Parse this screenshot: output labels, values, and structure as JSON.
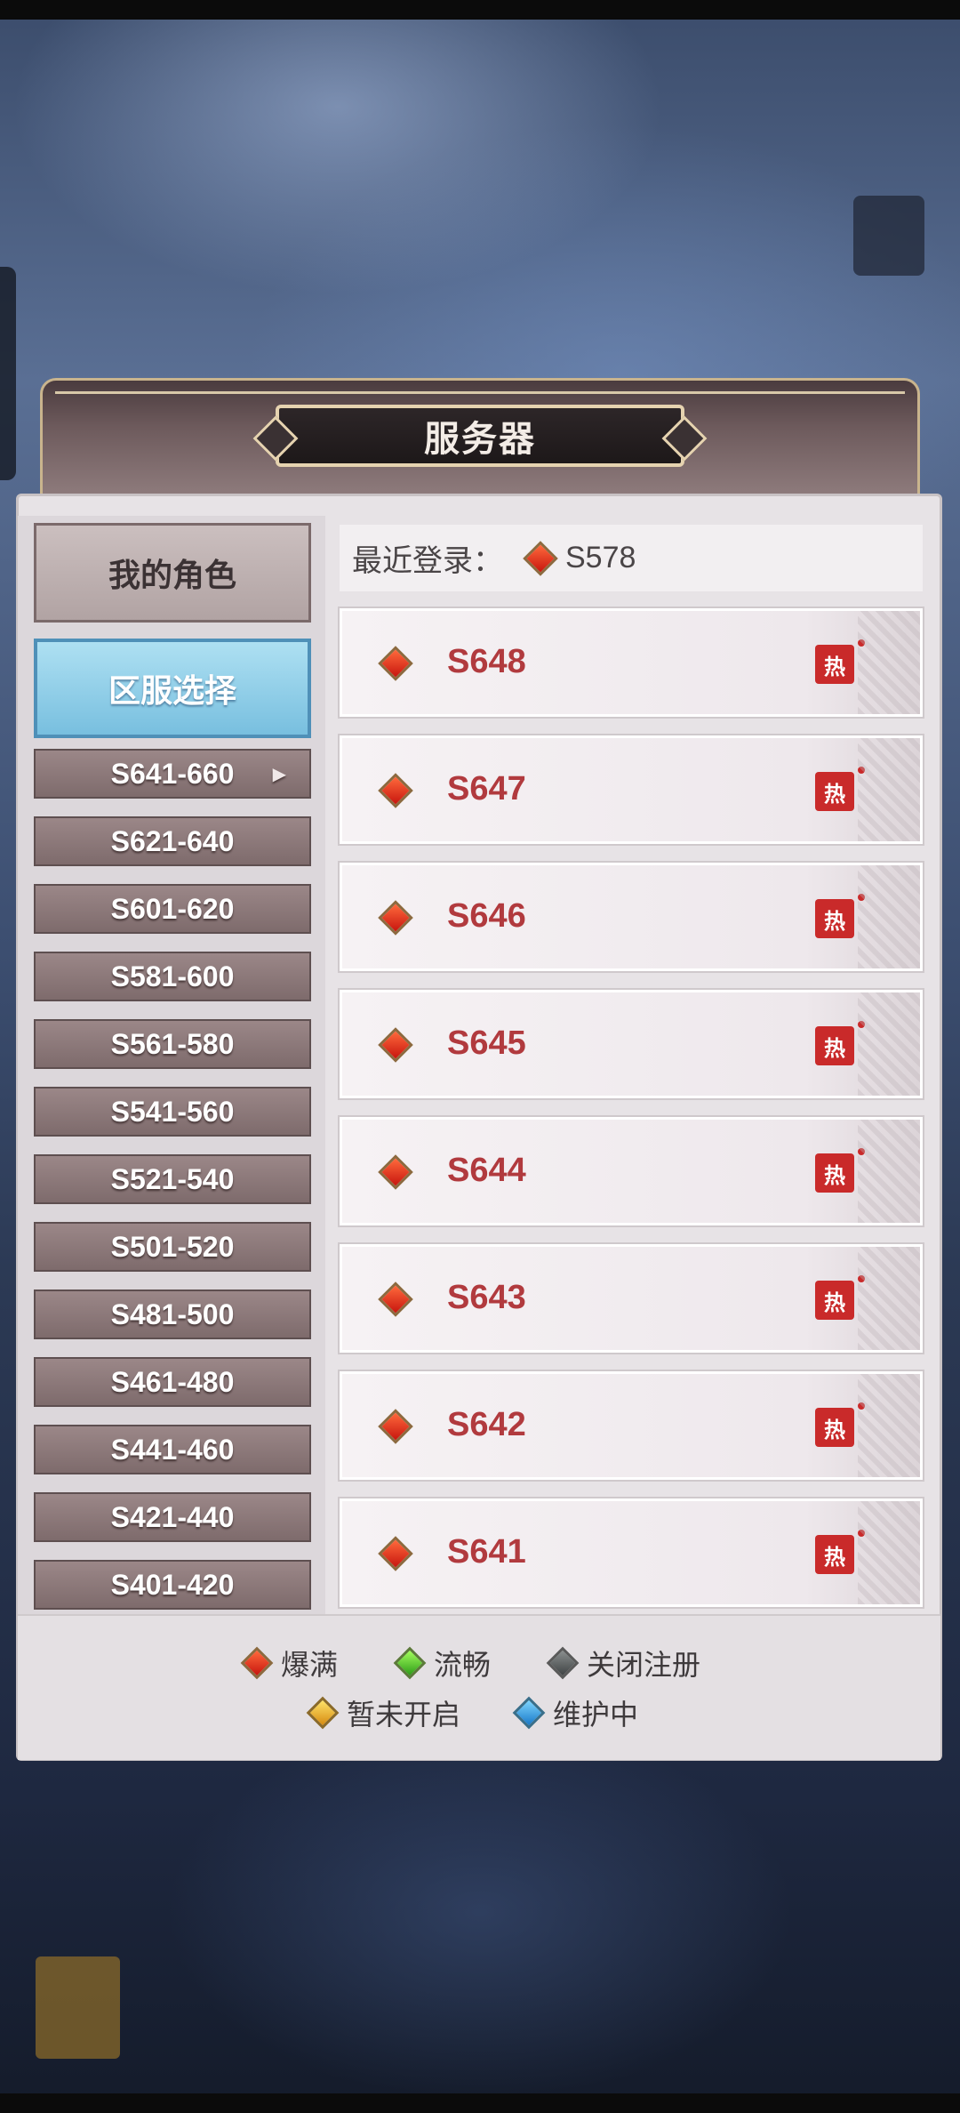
{
  "dialog": {
    "title": "服务器"
  },
  "nav": {
    "my_role": "我的角色",
    "server_select": "区服选择",
    "ranges": [
      "S641-660",
      "S621-640",
      "S601-620",
      "S581-600",
      "S561-580",
      "S541-560",
      "S521-540",
      "S501-520",
      "S481-500",
      "S461-480",
      "S441-460",
      "S421-440",
      "S401-420"
    ],
    "selected_range": "S641-660"
  },
  "recent": {
    "label": "最近登录：",
    "server": "S578",
    "status_icon": "red-gem-icon"
  },
  "servers": [
    {
      "name": "S648",
      "badge": "热",
      "status": "red"
    },
    {
      "name": "S647",
      "badge": "热",
      "status": "red"
    },
    {
      "name": "S646",
      "badge": "热",
      "status": "red"
    },
    {
      "name": "S645",
      "badge": "热",
      "status": "red"
    },
    {
      "name": "S644",
      "badge": "热",
      "status": "red"
    },
    {
      "name": "S643",
      "badge": "热",
      "status": "red"
    },
    {
      "name": "S642",
      "badge": "热",
      "status": "red"
    },
    {
      "name": "S641",
      "badge": "热",
      "status": "red"
    }
  ],
  "legend": [
    {
      "label": "爆满",
      "color": "#d0241a",
      "icon": "red-gem-icon"
    },
    {
      "label": "流畅",
      "color": "#3fb421",
      "icon": "green-gem-icon"
    },
    {
      "label": "关闭注册",
      "color": "#5a5e5f",
      "icon": "gray-gem-icon"
    },
    {
      "label": "暂未开启",
      "color": "#e8a81c",
      "icon": "yellow-gem-icon"
    },
    {
      "label": "维护中",
      "color": "#2a92de",
      "icon": "blue-gem-icon"
    }
  ]
}
